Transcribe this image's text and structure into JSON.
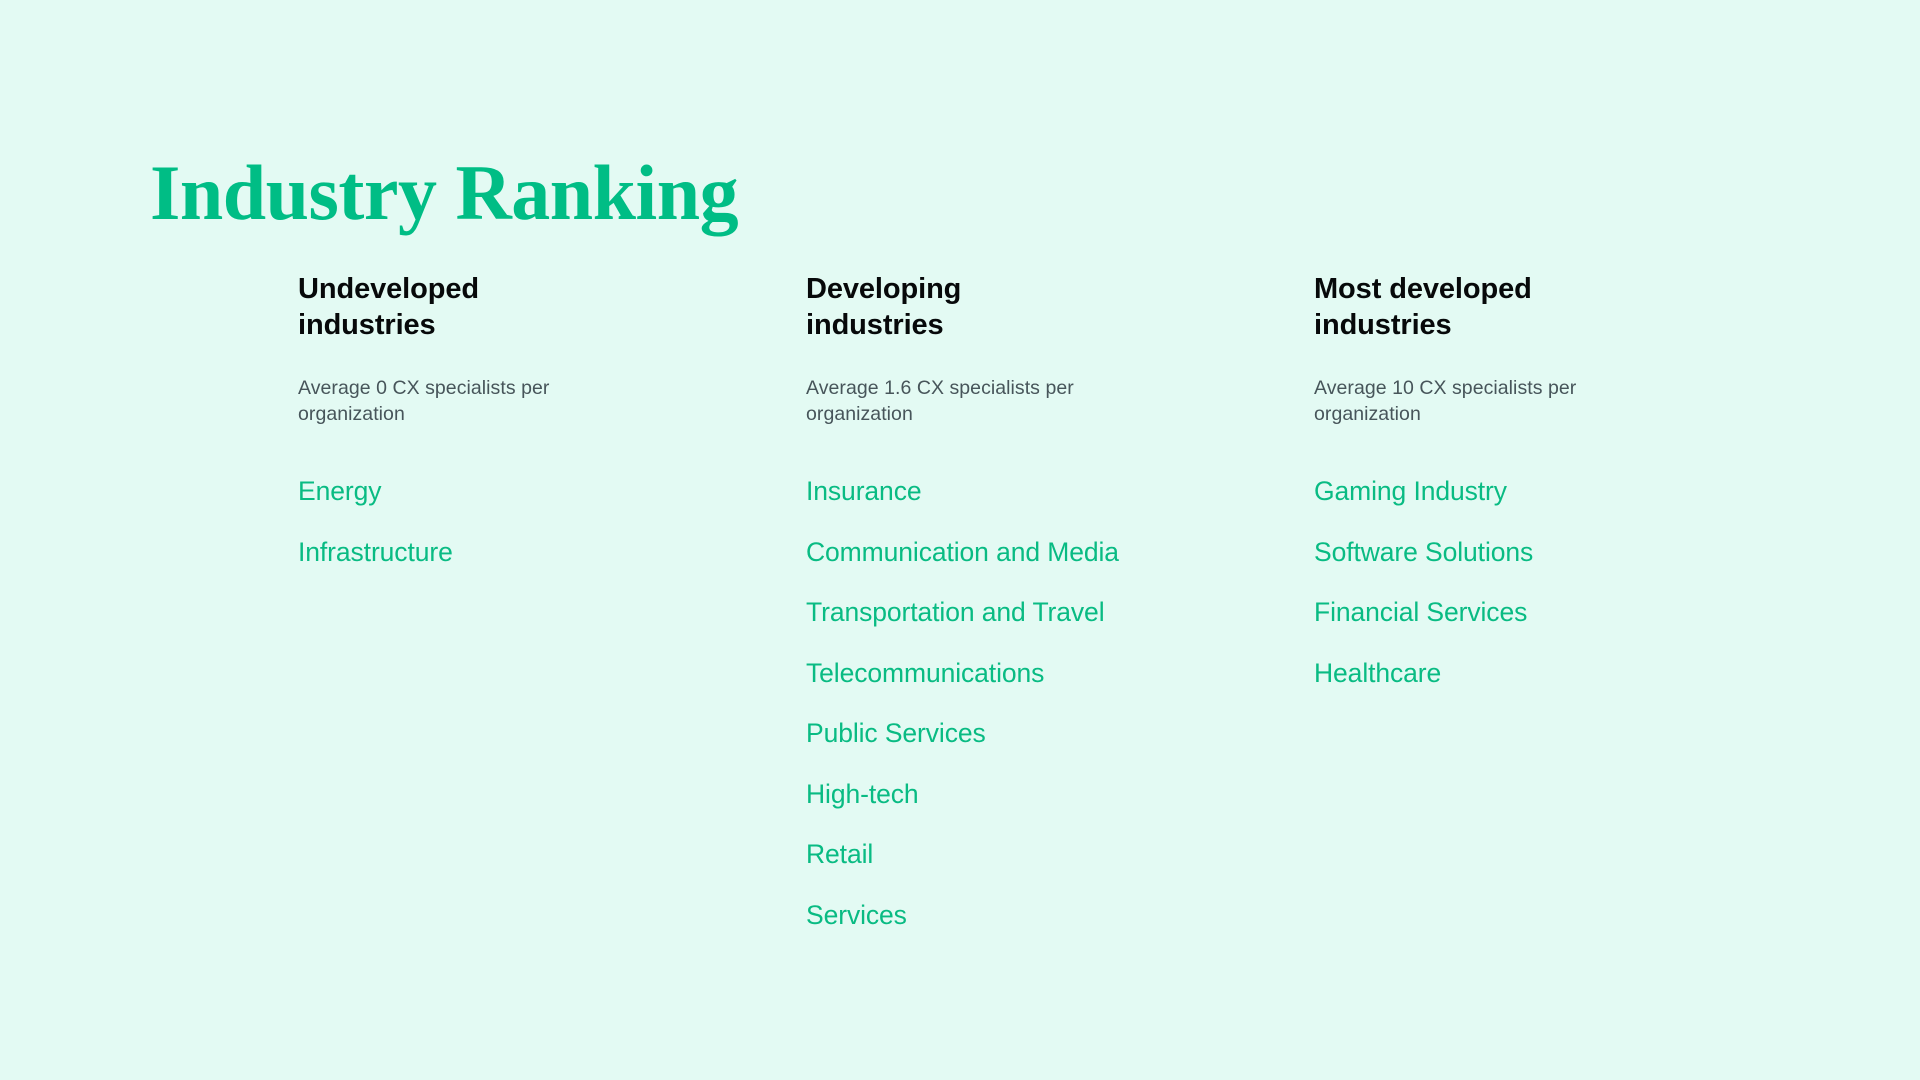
{
  "page": {
    "title": "Industry Ranking",
    "background_color": "#e3faf3",
    "accent_color": "#09bb83",
    "heading_color": "#07090a",
    "subtitle_color": "#47555a"
  },
  "columns": [
    {
      "heading": "Undeveloped industries",
      "subtitle": "Average 0 CX specialists per organization",
      "industries": [
        "Energy",
        "Infrastructure"
      ]
    },
    {
      "heading": "Developing industries",
      "subtitle": "Average 1.6 CX specialists per organization",
      "industries": [
        "Insurance",
        "Communication and Media",
        "Transportation and Travel",
        "Telecommunications",
        "Public Services",
        "High-tech",
        "Retail",
        "Services"
      ]
    },
    {
      "heading": "Most developed industries",
      "subtitle": "Average 10 CX specialists per organization",
      "industries": [
        "Gaming Industry",
        "Software Solutions",
        "Financial Services",
        "Healthcare"
      ]
    }
  ]
}
